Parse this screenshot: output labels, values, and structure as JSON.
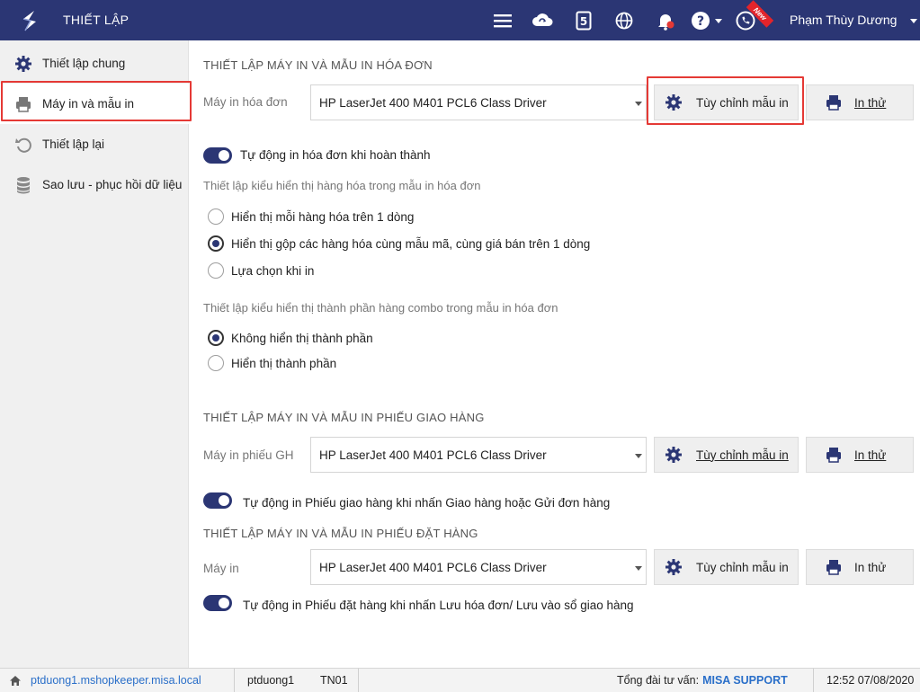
{
  "header": {
    "title": "THIẾT LẬP",
    "user_name": "Phạm Thùy Dương",
    "new_badge": "New",
    "icons": [
      "menu-icon",
      "cloud-sync-icon",
      "invoice-icon",
      "globe-icon",
      "bell-icon",
      "help-icon",
      "phone-icon"
    ]
  },
  "sidebar": {
    "items": [
      {
        "label": "Thiết lập chung",
        "icon": "gear-icon"
      },
      {
        "label": "Máy in và mẫu in",
        "icon": "printer-icon"
      },
      {
        "label": "Thiết lập lại",
        "icon": "reset-icon"
      },
      {
        "label": "Sao lưu - phục hồi dữ liệu",
        "icon": "database-icon"
      }
    ],
    "active_index": 1
  },
  "invoice_section": {
    "title": "THIẾT LẬP MÁY IN VÀ MẪU IN HÓA ĐƠN",
    "printer_label": "Máy in hóa đơn",
    "printer_value": "HP LaserJet 400 M401 PCL6 Class Driver",
    "customize_label": "Tùy chỉnh mẫu in",
    "test_label": "In thử",
    "auto_print_label": "Tự động in hóa đơn khi hoàn thành",
    "auto_print_on": true,
    "display_heading": "Thiết lập kiểu hiển thị hàng hóa trong mẫu in hóa đơn",
    "display_options": [
      {
        "label": "Hiển thị mỗi hàng hóa trên 1 dòng",
        "checked": false
      },
      {
        "label": "Hiển thị gộp các hàng hóa cùng mẫu mã, cùng giá bán trên 1 dòng",
        "checked": true
      },
      {
        "label": "Lựa chọn khi in",
        "checked": false
      }
    ],
    "combo_heading": "Thiết lập kiểu hiển thị thành phần hàng combo trong mẫu in hóa đơn",
    "combo_options": [
      {
        "label": "Không hiển thị thành phần",
        "checked": true
      },
      {
        "label": "Hiển thị thành phần",
        "checked": false
      }
    ]
  },
  "delivery_section": {
    "title": "THIẾT LẬP MÁY IN VÀ MẪU IN PHIẾU GIAO HÀNG",
    "printer_label": "Máy in phiếu GH",
    "printer_value": "HP LaserJet 400 M401 PCL6 Class Driver",
    "customize_label": "Tùy chỉnh mẫu in",
    "test_label": "In thử",
    "auto_print_label": "Tự động in Phiếu giao hàng khi nhấn Giao hàng hoặc Gửi đơn hàng",
    "auto_print_on": true
  },
  "order_section": {
    "title": "THIẾT LẬP MÁY IN VÀ MẪU IN PHIẾU ĐẶT HÀNG",
    "printer_label": "Máy in",
    "printer_value": "HP LaserJet 400 M401 PCL6 Class Driver",
    "customize_label": "Tùy chỉnh mẫu in",
    "test_label": "In thử",
    "auto_print_label": "Tự động in Phiếu đặt hàng khi nhấn Lưu hóa đơn/ Lưu vào sổ giao hàng",
    "auto_print_on": true
  },
  "statusbar": {
    "domain": "ptduong1.mshopkeeper.misa.local",
    "user": "ptduong1",
    "branch": "TN01",
    "hotline_label": "Tổng đài tư vấn:",
    "hotline_value": "MISA SUPPORT",
    "datetime": "12:52 07/08/2020"
  },
  "colors": {
    "header_bg": "#2b3674",
    "accent": "#2b3674",
    "highlight_border": "#e53935",
    "link": "#2a6fc9"
  }
}
